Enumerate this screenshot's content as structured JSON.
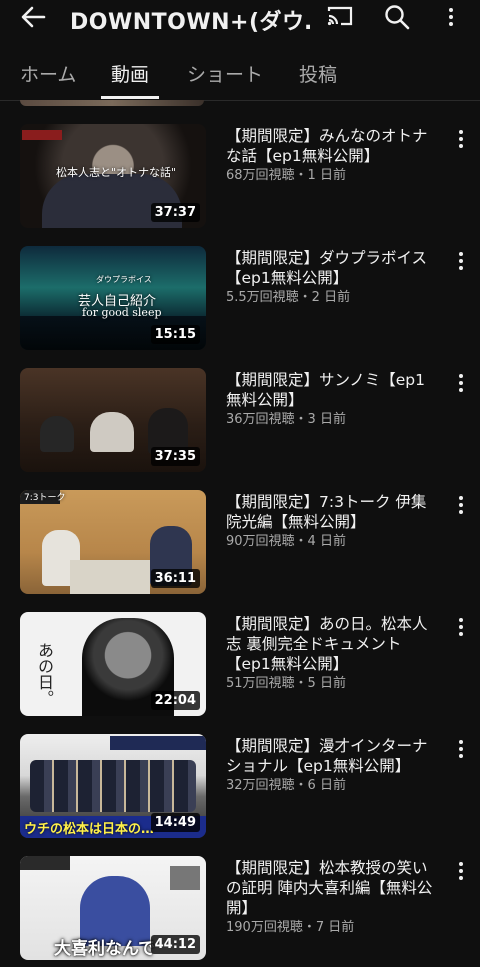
{
  "header": {
    "title": "DOWNTOWN+(ダウ…",
    "icons": [
      "back-arrow-icon",
      "cast-icon",
      "search-icon",
      "more-vert-icon"
    ]
  },
  "tabs": [
    {
      "label": "ホーム",
      "active": false
    },
    {
      "label": "動画",
      "active": true
    },
    {
      "label": "ショート",
      "active": false
    },
    {
      "label": "投稿",
      "active": false
    }
  ],
  "videos": [
    {
      "title": "【期間限定】みんなのオトナな話【ep1無料公開】",
      "meta": "68万回視聴・1 日前",
      "duration": "37:37",
      "thumb_text": "松本人志と\"オトナな話\""
    },
    {
      "title": "【期間限定】ダウプラボイス【ep1無料公開】",
      "meta": "5.5万回視聴・2 日前",
      "duration": "15:15",
      "thumb_text": "ダウプラボイス",
      "thumb_text2": "芸人自己紹介",
      "thumb_text3": "for good sleep"
    },
    {
      "title": "【期間限定】サンノミ【ep1無料公開】",
      "meta": "36万回視聴・3 日前",
      "duration": "37:35"
    },
    {
      "title": "【期間限定】7:3トーク 伊集院光編【無料公開】",
      "meta": "90万回視聴・4 日前",
      "duration": "36:11",
      "thumb_text": "7:3トーク"
    },
    {
      "title": "【期間限定】あの日。松本人志 裏側完全ドキュメント【ep1無料公開】",
      "meta": "51万回視聴・5 日前",
      "duration": "22:04",
      "thumb_text": "あの日。"
    },
    {
      "title": "【期間限定】漫才インターナショナル【ep1無料公開】",
      "meta": "32万回視聴・6 日前",
      "duration": "14:49",
      "thumb_text": "ウチの松本は日本の…"
    },
    {
      "title": "【期間限定】松本教授の笑いの証明 陣内大喜利編【無料公開】",
      "meta": "190万回視聴・7 日前",
      "duration": "44:12",
      "thumb_text": "大喜利なんで"
    }
  ]
}
